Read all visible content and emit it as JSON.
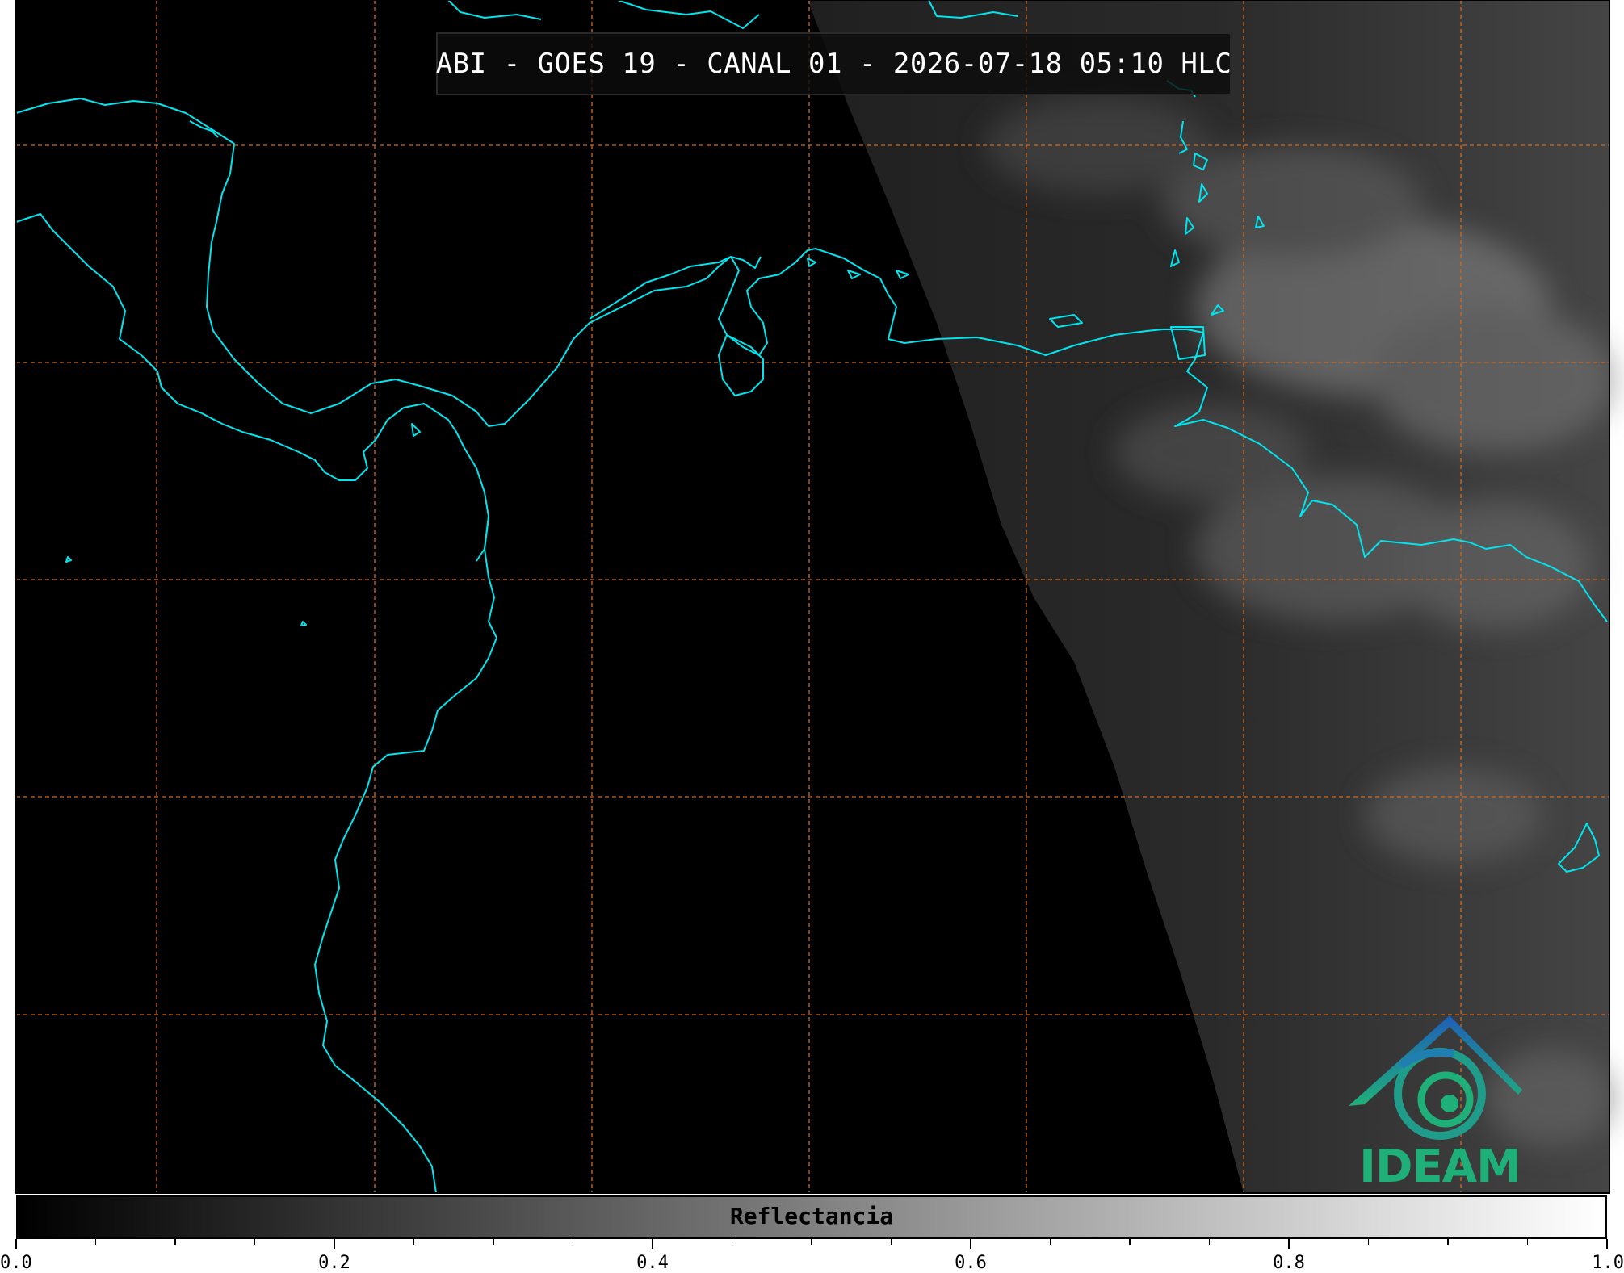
{
  "title": "ABI - GOES 19 - CANAL 01 - 2026-07-18 05:10 HLC",
  "logo": {
    "text": "IDEAM",
    "icon": "ideam-logo-icon",
    "colors": [
      "#1f6bb8",
      "#1fb07a"
    ]
  },
  "colorbar": {
    "label": "Reflectancia",
    "min": 0.0,
    "max": 1.0,
    "colormap": "greys",
    "ticks": [
      "0.0",
      "0.2",
      "0.4",
      "0.6",
      "0.8",
      "1.0"
    ]
  },
  "map": {
    "coastline_color": "#00e5ee",
    "gridline_color": "#d2691e",
    "gridline_style": "dashed"
  }
}
